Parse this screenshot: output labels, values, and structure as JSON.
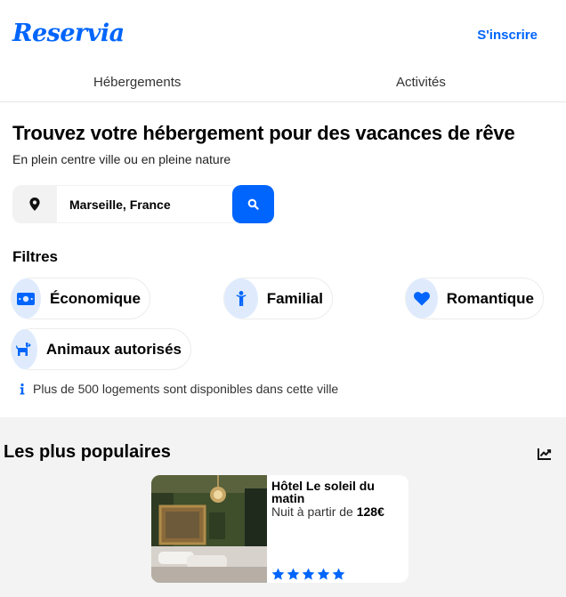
{
  "brand": {
    "name": "Reservia",
    "color": "#0065fc"
  },
  "header": {
    "signup_label": "S'inscrire"
  },
  "tabs": [
    {
      "label": "Hébergements"
    },
    {
      "label": "Activités"
    }
  ],
  "hero": {
    "title": "Trouvez votre hébergement pour des vacances de rêve",
    "subtitle": "En plein centre ville ou en pleine nature"
  },
  "search": {
    "value": "Marseille, France",
    "pin_icon": "location-pin-icon",
    "button_icon": "search-icon"
  },
  "filters": {
    "title": "Filtres",
    "items": [
      {
        "label": "Économique",
        "icon": "money-icon"
      },
      {
        "label": "Familial",
        "icon": "child-icon"
      },
      {
        "label": "Romantique",
        "icon": "heart-icon"
      },
      {
        "label": "Animaux autorisés",
        "icon": "dog-icon"
      }
    ]
  },
  "info": {
    "text": "Plus de 500 logements sont disponibles dans cette ville",
    "icon": "info-icon"
  },
  "popular": {
    "title": "Les plus populaires",
    "icon": "chart-line-icon",
    "cards": [
      {
        "name": "Hôtel Le soleil du matin",
        "price_prefix": "Nuit à partir de ",
        "price": "128€",
        "rating": 5
      }
    ]
  }
}
